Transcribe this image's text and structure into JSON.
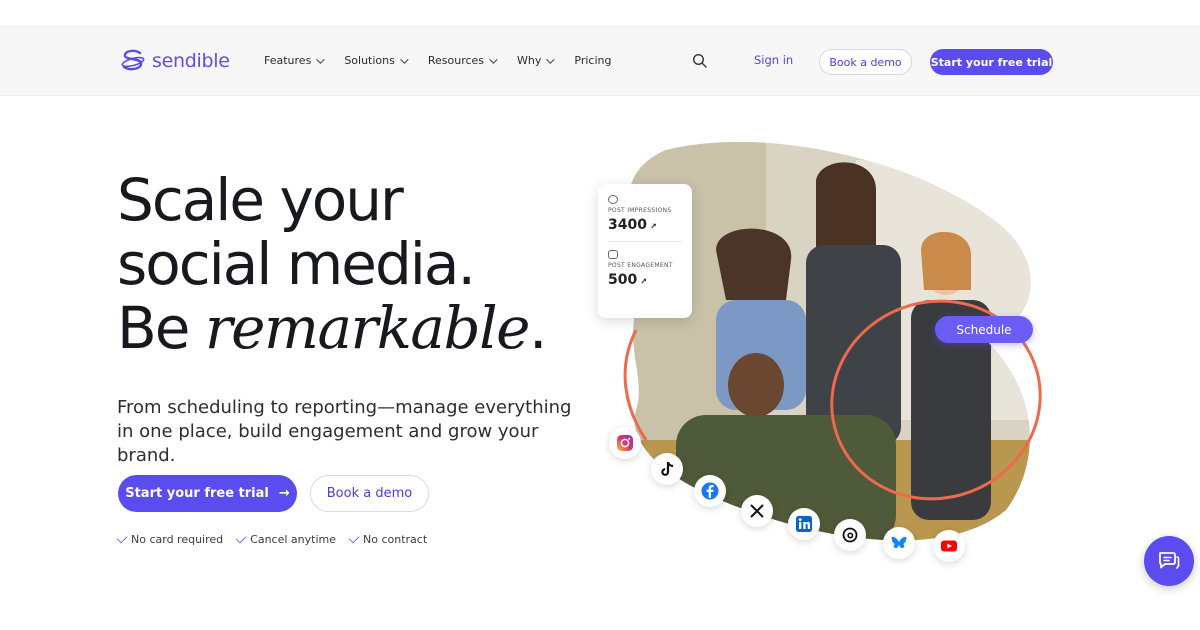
{
  "brand": {
    "name": "sendible",
    "color": "#5b4cf0"
  },
  "nav": {
    "items": [
      {
        "label": "Features",
        "dropdown": true
      },
      {
        "label": "Solutions",
        "dropdown": true
      },
      {
        "label": "Resources",
        "dropdown": true
      },
      {
        "label": "Why",
        "dropdown": true
      },
      {
        "label": "Pricing",
        "dropdown": false
      }
    ],
    "search_icon": "search-icon",
    "signin": "Sign in",
    "demo": "Book a demo",
    "trial": "Start your free trial"
  },
  "hero": {
    "line1": "Scale your",
    "line2": "social media.",
    "line3_a": "Be ",
    "line3_b": "remarkable",
    "line3_c": ".",
    "subtitle": "From scheduling to reporting—manage everything in one place, build engagement and grow your brand.",
    "cta_trial": "Start your free trial",
    "cta_trial_arrow": "→",
    "cta_demo": "Book a demo",
    "checks": [
      "No card required",
      "Cancel anytime",
      "No contract"
    ]
  },
  "stats": {
    "impressions_label": "POST IMPRESSIONS",
    "impressions_value": "3400",
    "engagement_label": "POST ENGAGEMENT",
    "engagement_value": "500",
    "trend_arrow": "↗"
  },
  "schedule_label": "Schedule",
  "social_icons": [
    "instagram-icon",
    "tiktok-icon",
    "facebook-icon",
    "x-icon",
    "linkedin-icon",
    "threads-icon",
    "bluesky-icon",
    "youtube-icon"
  ],
  "chat_icon": "chat-icon"
}
